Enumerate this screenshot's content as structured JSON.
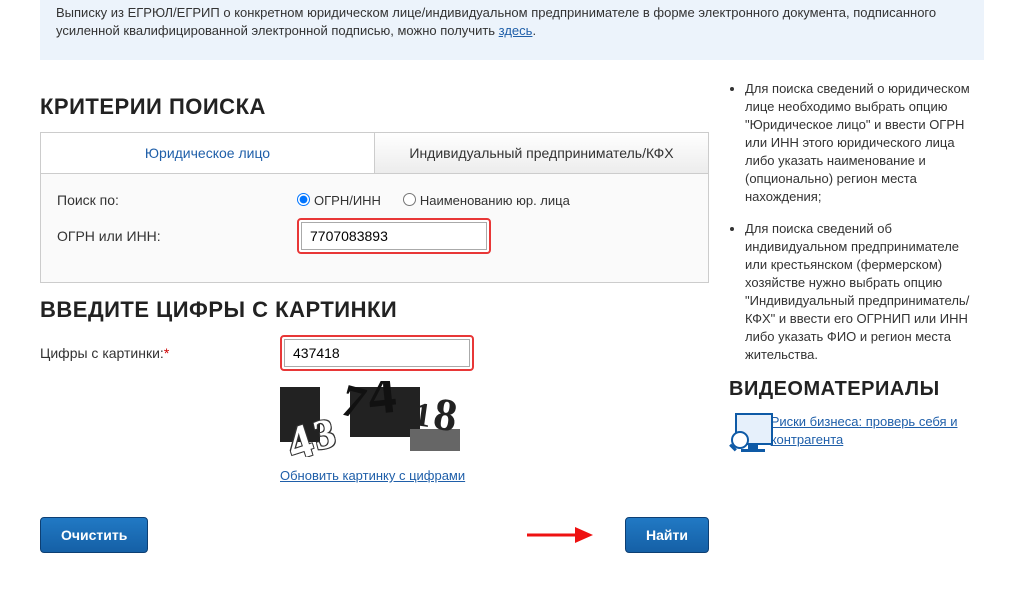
{
  "notice": {
    "text_before": "Выписку из ЕГРЮЛ/ЕГРИП о конкретном юридическом лице/индивидуальном предпринимателе в форме электронного документа, подписанного усиленной квалифицированной электронной подписью, можно получить ",
    "link_text": "здесь",
    "text_after": "."
  },
  "headings": {
    "criteria": "Критерии поиска",
    "captcha": "Введите цифры с картинки",
    "video": "Видеоматериалы"
  },
  "tabs": {
    "legal": "Юридическое лицо",
    "indiv": "Индивидуальный предприниматель/КФХ"
  },
  "form": {
    "search_by_label": "Поиск по:",
    "radio_ogrn_inn": "ОГРН/ИНН",
    "radio_name": "Наименованию юр. лица",
    "ogrn_label": "ОГРН или ИНН:",
    "ogrn_value": "7707083893",
    "captcha_label": "Цифры с картинки:",
    "captcha_value": "437418",
    "refresh_link": "Обновить картинку с цифрами",
    "captcha_glyphs": {
      "g1": "4",
      "g2": "3",
      "g3": "7",
      "g4": "4",
      "g5": "1",
      "g6": "8"
    },
    "btn_clear": "Очистить",
    "btn_find": "Найти"
  },
  "help": {
    "item1": "Для поиска сведений о юридическом лице необходимо выбрать опцию \"Юридическое лицо\" и ввести ОГРН или ИНН этого юридического лица либо указать наименование и (опционально) регион места нахождения;",
    "item2": "Для поиска сведений об индивидуальном предпринимателе или крестьянском (фермерском) хозяйстве нужно выбрать опцию \"Индивидуальный предприниматель/КФХ\" и ввести его ОГРНИП или ИНН либо указать ФИО и регион места жительства."
  },
  "video_link": "Риски бизнеса: проверь себя и контрагента",
  "colors": {
    "accent": "#1f5fa9",
    "danger": "#e83737"
  }
}
